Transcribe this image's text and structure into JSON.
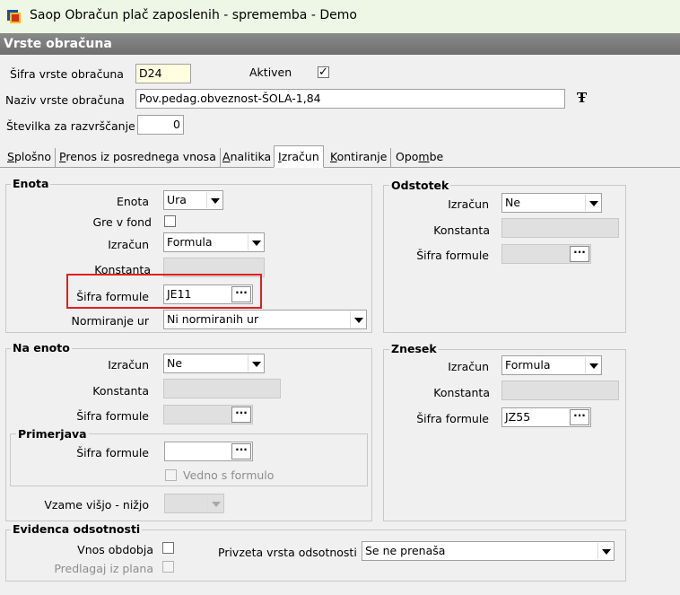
{
  "window": {
    "title": "Saop Obračun plač zaposlenih - sprememba - Demo",
    "header": "Vrste obračuna"
  },
  "form": {
    "code_label": "Šifra vrste obračuna",
    "code_value": "D24",
    "active_label": "Aktiven",
    "name_label": "Naziv vrste obračuna",
    "name_value": "Pov.pedag.obveznost-ŠOLA-1,84",
    "sort_label": "Številka  za razvrščanje",
    "sort_value": "0"
  },
  "tabs": [
    {
      "pre": "",
      "u": "S",
      "post": "plošno"
    },
    {
      "pre": "",
      "u": "P",
      "post": "renos iz posrednega vnosa"
    },
    {
      "pre": "",
      "u": "A",
      "post": "nalitika"
    },
    {
      "pre": "",
      "u": "I",
      "post": "zračun"
    },
    {
      "pre": "",
      "u": "K",
      "post": "ontiranje"
    },
    {
      "pre": "Opo",
      "u": "m",
      "post": "be"
    }
  ],
  "enota": {
    "title": "Enota",
    "enota_label": "Enota",
    "enota_value": "Ura",
    "fond_label": "Gre v fond",
    "izracun_label": "Izračun",
    "izracun_value": "Formula",
    "konstanta_label": "Konstanta",
    "formula_label": "Šifra formule",
    "formula_value": "JE11",
    "norm_label": "Normiranje ur",
    "norm_value": "Ni normiranih ur"
  },
  "odstotek": {
    "title": "Odstotek",
    "izracun_label": "Izračun",
    "izracun_value": "Ne",
    "konstanta_label": "Konstanta",
    "formula_label": "Šifra formule"
  },
  "na_enoto": {
    "title": "Na enoto",
    "izracun_label": "Izračun",
    "izracun_value": "Ne",
    "konstanta_label": "Konstanta",
    "formula_label": "Šifra formule",
    "primerjava": {
      "title": "Primerjava",
      "formula_label": "Šifra formule",
      "vedno_label": "Vedno s formulo"
    },
    "vzame_label": "Vzame višjo - nižjo"
  },
  "znesek": {
    "title": "Znesek",
    "izracun_label": "Izračun",
    "izracun_value": "Formula",
    "konstanta_label": "Konstanta",
    "formula_label": "Šifra formule",
    "formula_value": "JZ55"
  },
  "evidenca": {
    "title": "Evidenca odsotnosti",
    "vnos_label": "Vnos obdobja",
    "predlagaj_label": "Predlagaj iz plana",
    "privzeta_label": "Privzeta vrsta odsotnosti",
    "privzeta_value": "Se ne prenaša"
  },
  "icons": {
    "app": "payroll-app-icon",
    "font": "font-T-icon"
  },
  "colors": {
    "highlight": "#e02020",
    "header": "#7a7a7a",
    "code_bg": "#ffffe0"
  }
}
